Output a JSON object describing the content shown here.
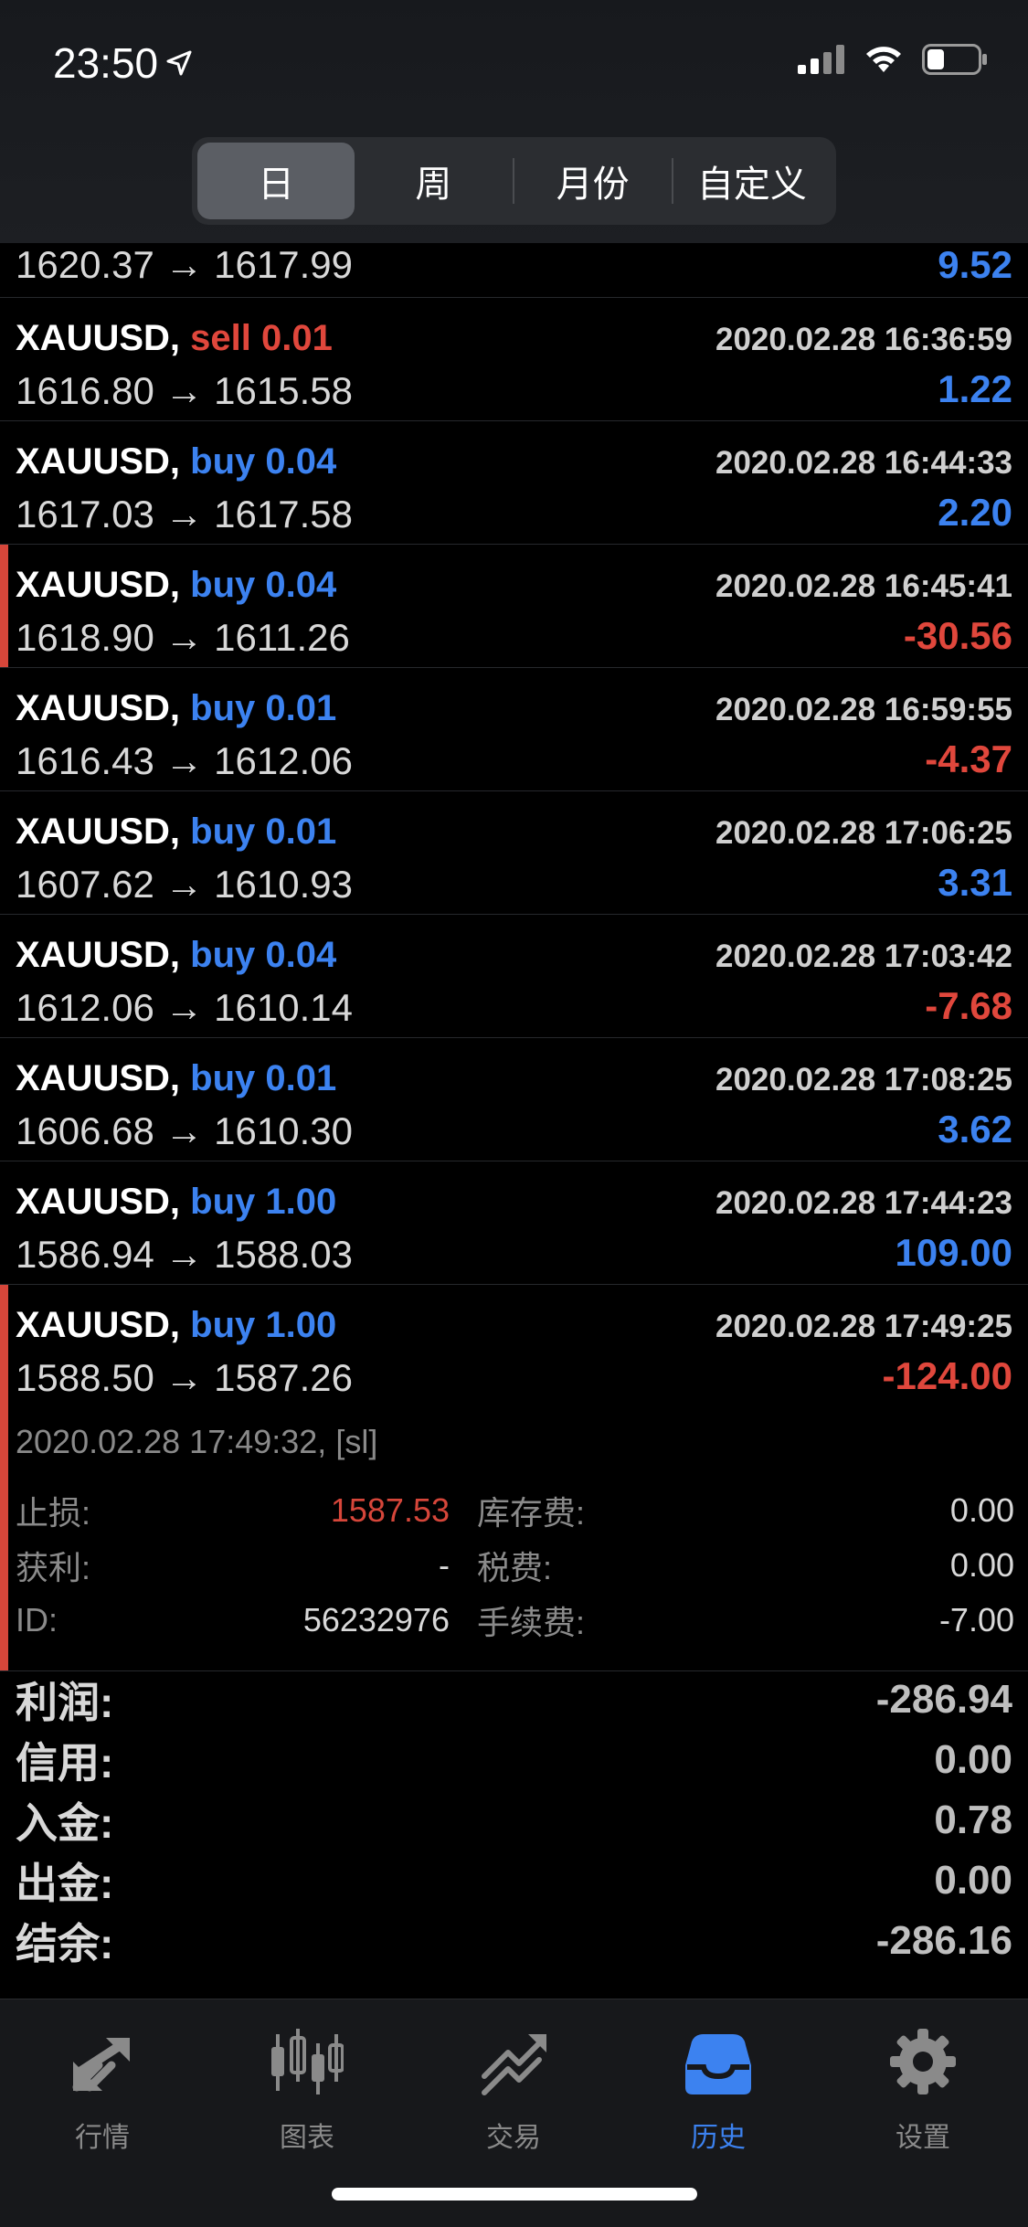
{
  "status": {
    "time": "23:50"
  },
  "segments": [
    {
      "label": "日",
      "active": true
    },
    {
      "label": "周",
      "active": false
    },
    {
      "label": "月份",
      "active": false
    },
    {
      "label": "自定义",
      "active": false
    }
  ],
  "partial_row": {
    "prices": "1620.37 → 1617.99",
    "profit": "9.52"
  },
  "trades": [
    {
      "symbol": "XAUUSD",
      "action": "sell 0.01",
      "side": "sell",
      "time": "2020.02.28 16:36:59",
      "prices": "1616.80 → 1615.58",
      "profit": "1.22"
    },
    {
      "symbol": "XAUUSD",
      "action": "buy 0.04",
      "side": "buy",
      "time": "2020.02.28 16:44:33",
      "prices": "1617.03 → 1617.58",
      "profit": "2.20"
    },
    {
      "symbol": "XAUUSD",
      "action": "buy 0.04",
      "side": "buy",
      "time": "2020.02.28 16:45:41",
      "prices": "1618.90 → 1611.26",
      "profit": "-30.56"
    },
    {
      "symbol": "XAUUSD",
      "action": "buy 0.01",
      "side": "buy",
      "time": "2020.02.28 16:59:55",
      "prices": "1616.43 → 1612.06",
      "profit": "-4.37"
    },
    {
      "symbol": "XAUUSD",
      "action": "buy 0.01",
      "side": "buy",
      "time": "2020.02.28 17:06:25",
      "prices": "1607.62 → 1610.93",
      "profit": "3.31"
    },
    {
      "symbol": "XAUUSD",
      "action": "buy 0.04",
      "side": "buy",
      "time": "2020.02.28 17:03:42",
      "prices": "1612.06 → 1610.14",
      "profit": "-7.68"
    },
    {
      "symbol": "XAUUSD",
      "action": "buy 0.01",
      "side": "buy",
      "time": "2020.02.28 17:08:25",
      "prices": "1606.68 → 1610.30",
      "profit": "3.62"
    },
    {
      "symbol": "XAUUSD",
      "action": "buy 1.00",
      "side": "buy",
      "time": "2020.02.28 17:44:23",
      "prices": "1586.94 → 1588.03",
      "profit": "109.00"
    },
    {
      "symbol": "XAUUSD",
      "action": "buy 1.00",
      "side": "buy",
      "time": "2020.02.28 17:49:25",
      "prices": "1588.50 → 1587.26",
      "profit": "-124.00"
    }
  ],
  "detail": {
    "close_info": "2020.02.28 17:49:32, [sl]",
    "sl_label": "止损:",
    "sl_value": "1587.53",
    "swap_label": "库存费:",
    "swap_value": "0.00",
    "tp_label": "获利:",
    "tp_value": "-",
    "tax_label": "税费:",
    "tax_value": "0.00",
    "id_label": "ID:",
    "id_value": "56232976",
    "fee_label": "手续费:",
    "fee_value": "-7.00"
  },
  "summary": [
    {
      "label": "利润:",
      "value": "-286.94"
    },
    {
      "label": "信用:",
      "value": "0.00"
    },
    {
      "label": "入金:",
      "value": "0.78"
    },
    {
      "label": "出金:",
      "value": "0.00"
    },
    {
      "label": "结余:",
      "value": "-286.16"
    }
  ],
  "tabs": [
    {
      "label": "行情",
      "icon": "quotes-icon",
      "active": false
    },
    {
      "label": "图表",
      "icon": "chart-icon",
      "active": false
    },
    {
      "label": "交易",
      "icon": "trade-icon",
      "active": false
    },
    {
      "label": "历史",
      "icon": "history-icon",
      "active": true
    },
    {
      "label": "设置",
      "icon": "settings-icon",
      "active": false
    }
  ],
  "colors": {
    "positive": "#3c82f0",
    "negative": "#e0473c",
    "accent": "#3c82f0"
  }
}
